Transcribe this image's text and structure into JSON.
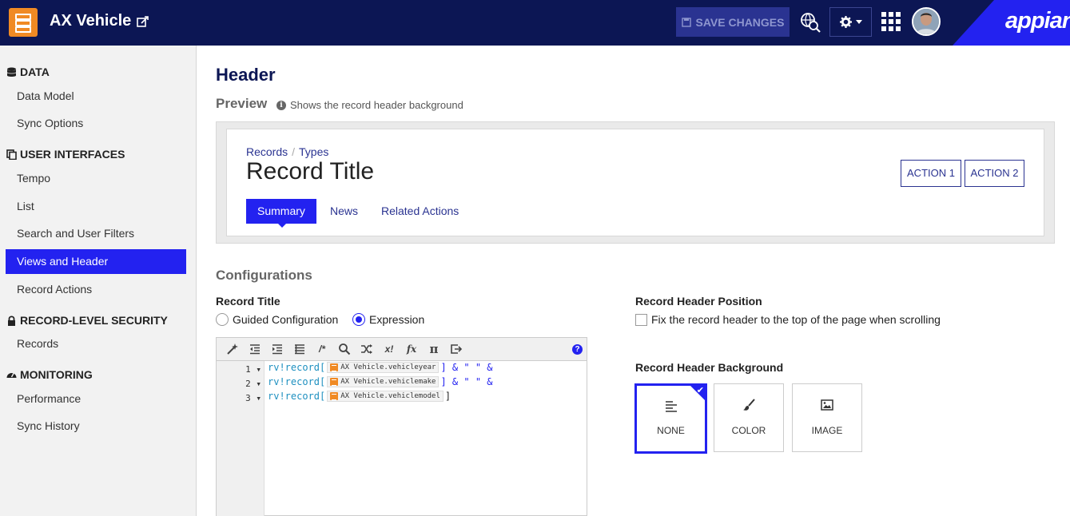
{
  "app": {
    "title": "AX Vehicle"
  },
  "header": {
    "save_label": "SAVE CHANGES",
    "brand": "appian"
  },
  "sidebar": {
    "sections": [
      {
        "title": "DATA",
        "items": [
          "Data Model",
          "Sync Options"
        ]
      },
      {
        "title": "USER INTERFACES",
        "items": [
          "Tempo",
          "List",
          "Search and User Filters",
          "Views and Header",
          "Record Actions"
        ]
      },
      {
        "title": "RECORD-LEVEL SECURITY",
        "items": [
          "Records"
        ]
      },
      {
        "title": "MONITORING",
        "items": [
          "Performance",
          "Sync History"
        ]
      }
    ],
    "active": "Views and Header"
  },
  "main": {
    "title": "Header",
    "preview_label": "Preview",
    "preview_info": "Shows the record header background",
    "preview": {
      "breadcrumbs": [
        "Records",
        "Types"
      ],
      "record_title": "Record Title",
      "actions": [
        "ACTION 1",
        "ACTION 2"
      ],
      "tabs": [
        "Summary",
        "News",
        "Related Actions"
      ],
      "active_tab": "Summary"
    },
    "config_label": "Configurations",
    "record_title_field": {
      "label": "Record Title",
      "options": [
        "Guided Configuration",
        "Expression"
      ],
      "selected": "Expression"
    },
    "position_field": {
      "label": "Record Header Position",
      "checkbox": "Fix the record header to the top of the page when scrolling",
      "checked": false
    },
    "background_field": {
      "label": "Record Header Background",
      "options": [
        "NONE",
        "COLOR",
        "IMAGE"
      ],
      "selected": "NONE"
    },
    "editor": {
      "lines": [
        {
          "num": "1",
          "prefix": "rv!record[",
          "field": "AX Vehicle.vehicleyear",
          "suffix": "] & \" \" &"
        },
        {
          "num": "2",
          "prefix": "rv!record[",
          "field": "AX Vehicle.vehiclemake",
          "suffix": "] & \" \" &"
        },
        {
          "num": "3",
          "prefix": "rv!record[",
          "field": "AX Vehicle.vehiclemodel",
          "suffix": "]"
        }
      ]
    }
  },
  "colors": {
    "topbar": "#0c1654",
    "accent": "#2322f0",
    "app_icon": "#f08a24"
  }
}
